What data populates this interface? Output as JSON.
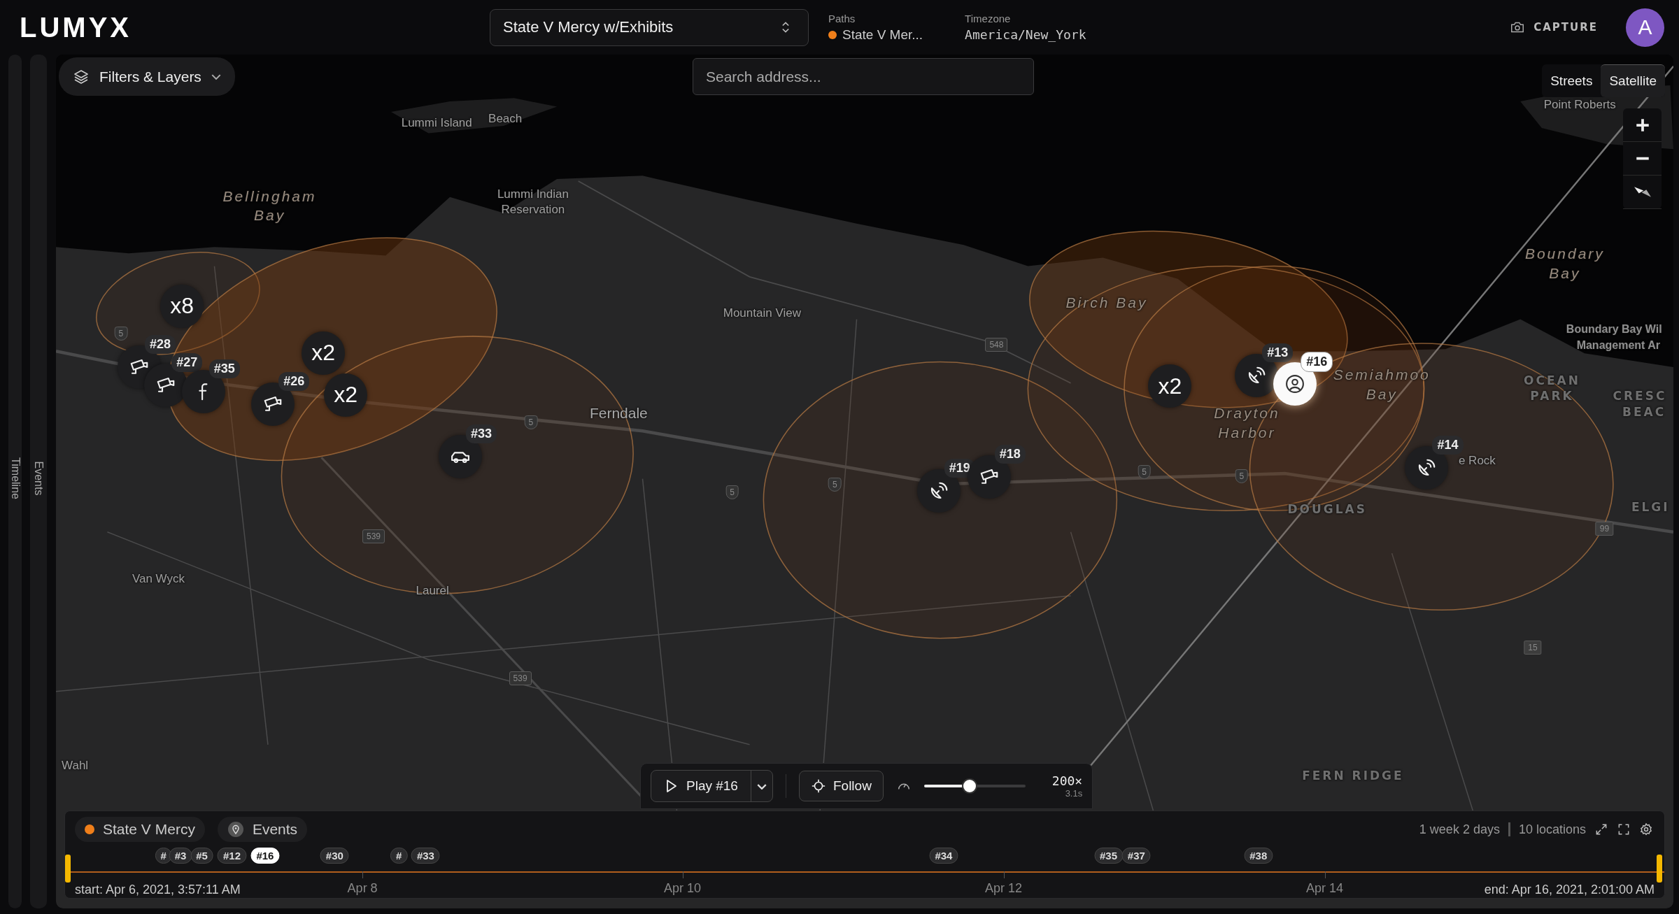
{
  "header": {
    "logo": "LUMYX",
    "case_select": {
      "value": "State V Mercy w/Exhibits"
    },
    "paths": {
      "label": "Paths",
      "value": "State V Mer..."
    },
    "timezone": {
      "label": "Timezone",
      "value": "America/New_York"
    },
    "capture": "CAPTURE",
    "avatar": "A"
  },
  "side_rail": [
    {
      "label": "Timeline"
    },
    {
      "label": "Events"
    }
  ],
  "filters_button": "Filters & Layers",
  "search": {
    "placeholder": "Search address..."
  },
  "map_style_tabs": [
    {
      "label": "Streets",
      "selected": false
    },
    {
      "label": "Satellite",
      "selected": true
    }
  ],
  "map_labels": [
    {
      "text": "Point Roberts",
      "kind": "town"
    },
    {
      "text": "Beach",
      "kind": "town"
    },
    {
      "text": "Lummi Island",
      "kind": "town"
    },
    {
      "text": "Bellingham Bay",
      "kind": "water"
    },
    {
      "text": "Lummi Indian Reservation",
      "kind": "town"
    },
    {
      "text": "Boundary Bay",
      "kind": "water"
    },
    {
      "text": "Birch Bay",
      "kind": "water"
    },
    {
      "text": "Mountain View",
      "kind": "town"
    },
    {
      "text": "Boundary Bay Wil",
      "kind": "poi"
    },
    {
      "text": "Management Ar",
      "kind": "poi"
    },
    {
      "text": "Semiahmoo Bay",
      "kind": "water"
    },
    {
      "text": "OCEAN PARK",
      "kind": "district"
    },
    {
      "text": "CRESC",
      "kind": "district"
    },
    {
      "text": "Ferndale",
      "kind": "city"
    },
    {
      "text": "Drayton Harbor",
      "kind": "water"
    },
    {
      "text": "BEAC",
      "kind": "district"
    },
    {
      "text": "e Rock",
      "kind": "town"
    },
    {
      "text": "DOUGLAS",
      "kind": "district"
    },
    {
      "text": "ELGI",
      "kind": "district"
    },
    {
      "text": "Van Wyck",
      "kind": "town"
    },
    {
      "text": "Laurel",
      "kind": "town"
    },
    {
      "text": "Wahl",
      "kind": "town"
    },
    {
      "text": "FERN RIDGE",
      "kind": "district"
    }
  ],
  "road_shields": [
    {
      "text": "5",
      "kind": "interstate"
    },
    {
      "text": "5",
      "kind": "interstate"
    },
    {
      "text": "5",
      "kind": "interstate"
    },
    {
      "text": "5",
      "kind": "interstate"
    },
    {
      "text": "5",
      "kind": "interstate"
    },
    {
      "text": "5",
      "kind": "interstate"
    },
    {
      "text": "539",
      "kind": "state"
    },
    {
      "text": "539",
      "kind": "state"
    },
    {
      "text": "548",
      "kind": "state"
    },
    {
      "text": "15",
      "kind": "route"
    },
    {
      "text": "99",
      "kind": "route"
    }
  ],
  "markers": [
    {
      "kind": "cluster",
      "label": "x8",
      "selected": false
    },
    {
      "kind": "cluster",
      "label": "x2",
      "selected": false
    },
    {
      "kind": "cluster",
      "label": "x2",
      "selected": false
    },
    {
      "kind": "camera",
      "label": "#28",
      "selected": false
    },
    {
      "kind": "camera",
      "label": "#27",
      "selected": false
    },
    {
      "kind": "social",
      "label": "#35",
      "selected": false
    },
    {
      "kind": "camera",
      "label": "#26",
      "selected": false
    },
    {
      "kind": "car",
      "label": "#33",
      "selected": false
    },
    {
      "kind": "dish",
      "label": "#19",
      "selected": false
    },
    {
      "kind": "camera",
      "label": "#18",
      "selected": false
    },
    {
      "kind": "cluster",
      "label": "x2",
      "selected": false
    },
    {
      "kind": "dish",
      "label": "#13",
      "selected": false
    },
    {
      "kind": "person",
      "label": "#16",
      "selected": true
    },
    {
      "kind": "dish",
      "label": "#14",
      "selected": false
    }
  ],
  "playback": {
    "play_label": "Play #16",
    "follow_label": "Follow",
    "speed": {
      "level": 0.45
    },
    "rate": "200×",
    "duration": "3.1s"
  },
  "timeline": {
    "legend": [
      {
        "kind": "path",
        "label": "State V Mercy",
        "color": "#f07f1a"
      },
      {
        "kind": "events",
        "label": "Events"
      }
    ],
    "summary": {
      "duration": "1 week 2 days",
      "locations": "10 locations"
    },
    "pins": [
      {
        "label": "#",
        "selected": false
      },
      {
        "label": "#3",
        "selected": false
      },
      {
        "label": "#5",
        "selected": false
      },
      {
        "label": "#12",
        "selected": false
      },
      {
        "label": "#16",
        "selected": true
      },
      {
        "label": "#30",
        "selected": false
      },
      {
        "label": "#",
        "selected": false
      },
      {
        "label": "#33",
        "selected": false
      },
      {
        "label": "#34",
        "selected": false
      },
      {
        "label": "#35",
        "selected": false
      },
      {
        "label": "#37",
        "selected": false
      },
      {
        "label": "#38",
        "selected": false
      }
    ],
    "ticks": [
      "Apr 8",
      "Apr 10",
      "Apr 12",
      "Apr 14"
    ],
    "start": "start: Apr 6, 2021, 3:57:11 AM",
    "end": "end: Apr 16, 2021, 2:01:00 AM"
  }
}
